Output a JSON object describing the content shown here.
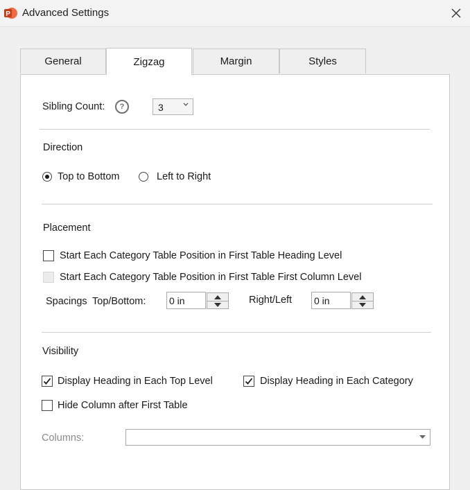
{
  "window": {
    "title": "Advanced Settings",
    "app_icon": "powerpoint-icon",
    "close_icon": "close-icon"
  },
  "tabs": [
    {
      "label": "General",
      "active": false
    },
    {
      "label": "Zigzag",
      "active": true
    },
    {
      "label": "Margin",
      "active": false
    },
    {
      "label": "Styles",
      "active": false
    }
  ],
  "sibling": {
    "label": "Sibling Count:",
    "help_icon": "question-icon",
    "help_glyph": "?",
    "value": "3"
  },
  "direction": {
    "heading": "Direction",
    "options": [
      {
        "label": "Top to Bottom",
        "selected": true
      },
      {
        "label": "Left to Right",
        "selected": false
      }
    ]
  },
  "placement": {
    "heading": "Placement",
    "checkbox1": {
      "label": "Start Each Category Table Position in First Table Heading Level",
      "checked": false
    },
    "checkbox2": {
      "label": "Start Each Category Table Position in First Table First Column Level",
      "checked": false,
      "disabled": true
    },
    "spacings_label": "Spacings",
    "top_bottom_label": "Top/Bottom:",
    "top_bottom_value": "0 in",
    "right_left_label": "Right/Left",
    "right_left_value": "0 in"
  },
  "visibility": {
    "heading": "Visibility",
    "display_heading_top": {
      "label": "Display Heading in Each Top Level",
      "checked": true
    },
    "display_heading_category": {
      "label": "Display Heading in Each Category",
      "checked": true
    },
    "hide_column": {
      "label": "Hide Column after First Table",
      "checked": false
    },
    "columns_label": "Columns:",
    "columns_value": ""
  },
  "colors": {
    "accent": "#d04423",
    "panel_bg": "#ffffff",
    "window_bg": "#f0f0f0",
    "disabled_text": "#8a8a8a"
  }
}
